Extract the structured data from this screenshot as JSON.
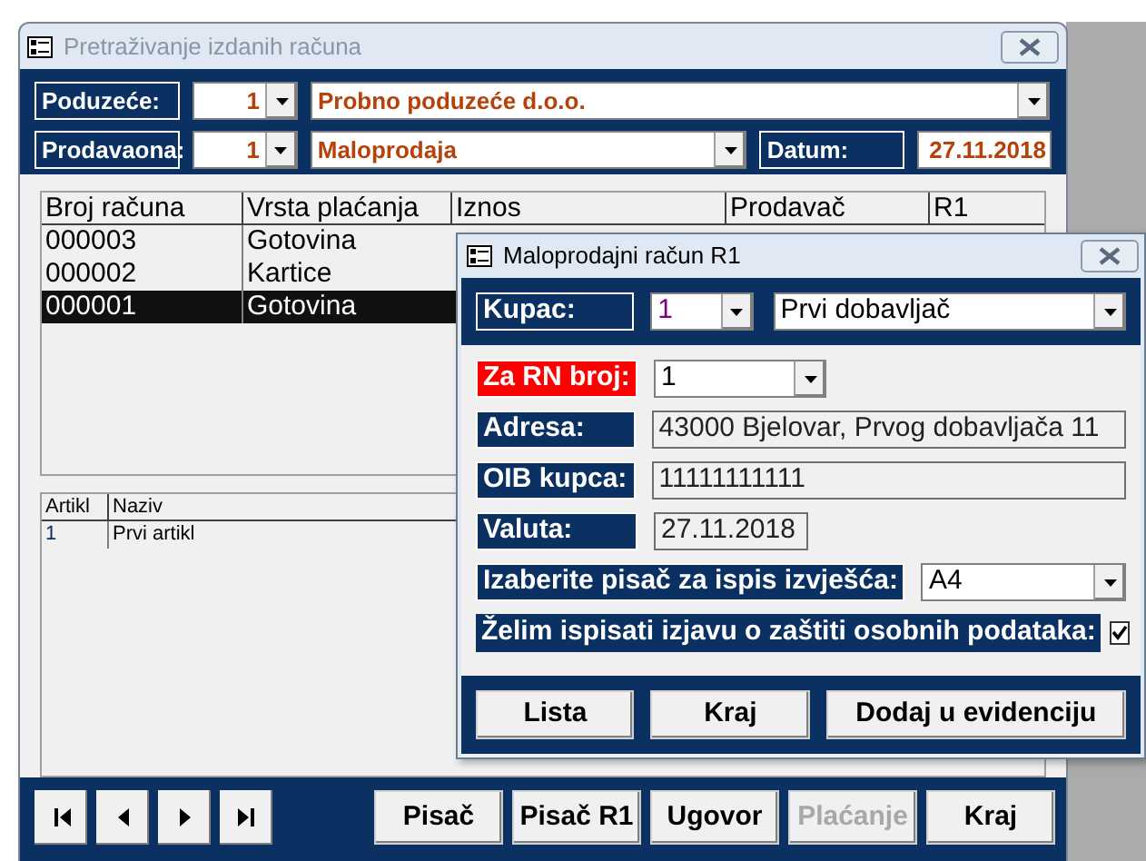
{
  "main_window": {
    "title": "Pretraživanje izdanih računa",
    "header": {
      "company_label": "Poduzeće:",
      "company_id": "1",
      "company_name": "Probno poduzeće d.o.o.",
      "store_label": "Prodavaona:",
      "store_id": "1",
      "store_name": "Maloprodaja",
      "date_label": "Datum:",
      "date": "27.11.2018"
    },
    "invoices": {
      "columns": [
        "Broj računa",
        "Vrsta plaćanja",
        "Iznos",
        "Prodavač",
        "R1"
      ],
      "rows": [
        {
          "number": "000003",
          "payment": "Gotovina",
          "selected": false
        },
        {
          "number": "000002",
          "payment": "Kartice",
          "selected": false
        },
        {
          "number": "000001",
          "payment": "Gotovina",
          "selected": true
        }
      ]
    },
    "items": {
      "columns": [
        "Artikl",
        "Naziv"
      ],
      "rows": [
        {
          "code": "1",
          "name": "Prvi artikl"
        }
      ]
    },
    "buttons": [
      {
        "label": "Pisač",
        "disabled": false
      },
      {
        "label": "Pisač R1",
        "disabled": false
      },
      {
        "label": "Ugovor",
        "disabled": false
      },
      {
        "label": "Plaćanje",
        "disabled": true
      },
      {
        "label": "Kraj",
        "disabled": false
      }
    ]
  },
  "dialog": {
    "title": "Maloprodajni račun R1",
    "customer_label": "Kupac:",
    "customer_id": "1",
    "customer_name": "Prvi dobavljač",
    "invoice_ref_label": "Za RN broj:",
    "invoice_ref": "1",
    "address_label": "Adresa:",
    "address": "43000 Bjelovar, Prvog dobavljača 11",
    "oib_label": "OIB kupca:",
    "oib": "11111111111",
    "currency_date_label": "Valuta:",
    "currency_date": "27.11.2018",
    "printer_label": "Izaberite pisač za ispis izvješća:",
    "printer": "A4",
    "privacy_label": "Želim ispisati izjavu o zaštiti osobnih podataka:",
    "privacy_checked": true,
    "buttons": [
      {
        "label": "Lista"
      },
      {
        "label": "Kraj"
      },
      {
        "label": "Dodaj u evidenciju"
      }
    ]
  }
}
